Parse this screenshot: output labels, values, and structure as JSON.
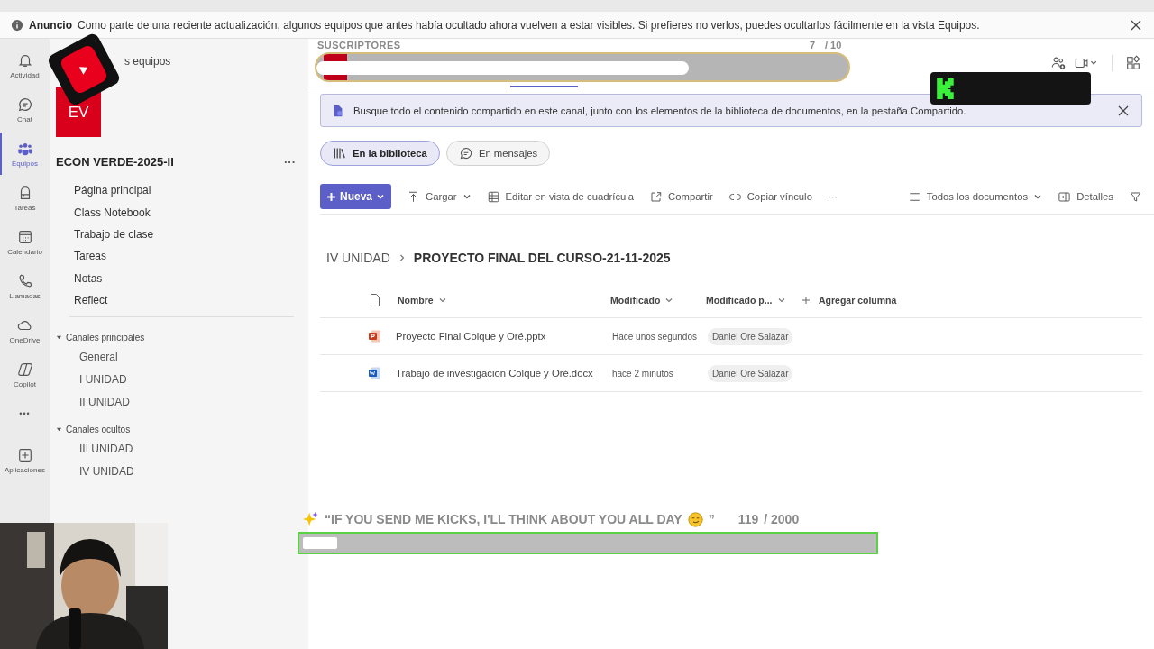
{
  "announcement": {
    "label": "Anuncio",
    "text": "Como parte de una reciente actualización, algunos equipos que antes había ocultado ahora vuelven a estar visibles. Si prefieres no verlos, puedes ocultarlos fácilmente en la vista Equipos."
  },
  "rail": [
    {
      "kind": "app",
      "label": "Actividad",
      "selected": false
    },
    {
      "kind": "app",
      "label": "Chat",
      "selected": false
    },
    {
      "kind": "app",
      "label": "Equipos",
      "selected": true
    },
    {
      "kind": "app",
      "label": "Tareas",
      "selected": false
    },
    {
      "kind": "app",
      "label": "Calendario",
      "selected": false
    },
    {
      "kind": "app",
      "label": "Llamadas",
      "selected": false
    },
    {
      "kind": "app",
      "label": "OneDrive",
      "selected": false
    },
    {
      "kind": "app",
      "label": "Copilot",
      "selected": false
    },
    {
      "kind": "more",
      "label": "•••"
    },
    {
      "kind": "app",
      "label": "Aplicaciones",
      "selected": false
    }
  ],
  "sidebar": {
    "header": "s equipos",
    "team_initials": "EV",
    "team_name": "ECON VERDE-2025-II",
    "team_more": "···",
    "nav": [
      "Página principal",
      "Class Notebook",
      "Trabajo de clase",
      "Tareas",
      "Notas",
      "Reflect"
    ],
    "channel_groups": [
      {
        "title": "Canales principales",
        "expanded": true,
        "channels": [
          "General",
          "I UNIDAD",
          "II UNIDAD"
        ]
      },
      {
        "title": "Canales ocultos",
        "expanded": true,
        "channels": [
          "III UNIDAD",
          "IV UNIDAD"
        ]
      }
    ]
  },
  "banner": {
    "text": "Busque todo el contenido compartido en este canal, junto con los elementos de la biblioteca de documentos, en la pestaña Compartido."
  },
  "view_tabs": [
    {
      "label": "En la biblioteca",
      "selected": true
    },
    {
      "label": "En mensajes",
      "selected": false
    }
  ],
  "toolbar": {
    "left": [
      {
        "kind": "primary",
        "label": "Nueva"
      },
      {
        "kind": "menu",
        "label": "Cargar"
      },
      {
        "kind": "plain",
        "label": "Editar en vista de cuadrícula"
      },
      {
        "kind": "plain",
        "label": "Compartir"
      },
      {
        "kind": "plain",
        "label": "Copiar vínculo"
      },
      {
        "kind": "more",
        "label": "···"
      }
    ],
    "right": [
      {
        "kind": "menu",
        "label": "Todos los documentos"
      },
      {
        "kind": "plain",
        "label": "Detalles"
      },
      {
        "kind": "icon"
      }
    ]
  },
  "breadcrumb": [
    "IV UNIDAD",
    "PROYECTO FINAL DEL CURSO-21-11-2025"
  ],
  "table": {
    "columns": [
      "Nombre",
      "Modificado",
      "Modificado p..."
    ],
    "add_column": "Agregar columna",
    "rows": [
      {
        "kind": "presentation",
        "name": "Proyecto Final Colque y Oré.pptx",
        "modified": "Hace unos segundos",
        "modified_by": "Daniel Ore Salazar"
      },
      {
        "kind": "document",
        "name": "Trabajo de investigacion Colque y Oré.docx",
        "modified": "hace 2 minutos",
        "modified_by": "Daniel Ore Salazar"
      }
    ]
  },
  "overlays": {
    "subscriber_goal": {
      "title": "SUSCRIPTORES",
      "count": "7",
      "total": "/ 10",
      "level": 0.7
    },
    "kick_goal": {
      "text": "“IF YOU SEND ME KICKS, I'LL THINK ABOUT YOU ALL DAY",
      "close_quote": "”",
      "count": "119",
      "total": "/ 2000",
      "level": 0.06
    }
  }
}
